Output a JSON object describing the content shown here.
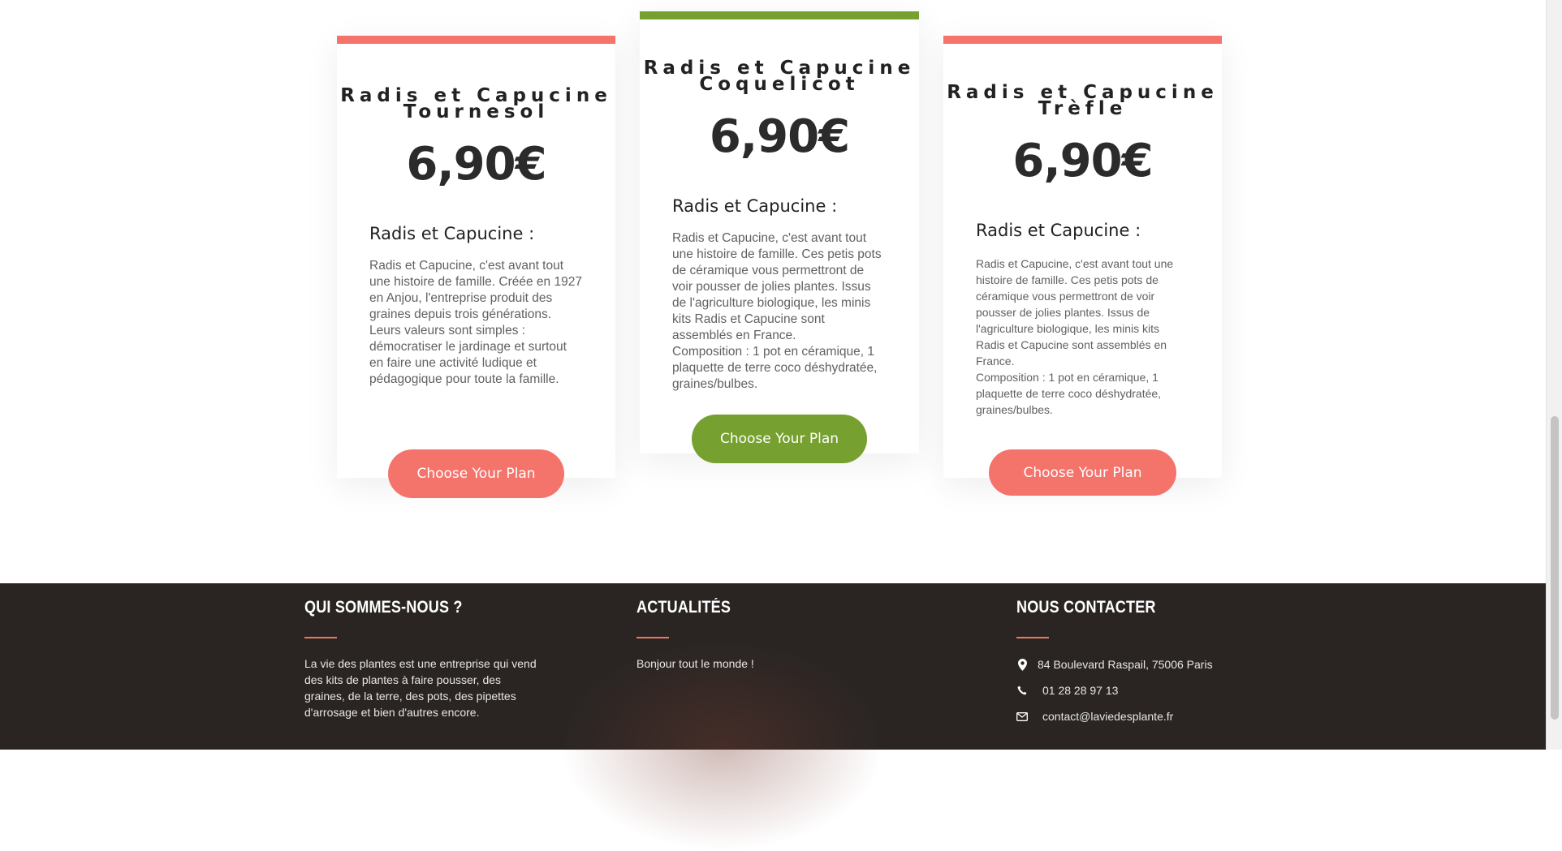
{
  "pricing": {
    "cards": [
      {
        "title_line1": "Radis et Capucine",
        "title_line2": "Tournesol",
        "price": "6,90€",
        "heading": "Radis et Capucine :",
        "description": "Radis et Capucine, c'est avant tout\nune histoire de famille. Créée en 1927\nen Anjou, l'entreprise produit des\ngraines depuis trois générations.\nLeurs valeurs sont simples :\ndémocratiser le jardinage et surtout\nen faire une activité ludique et\npédagogique pour toute la famille.",
        "button_label": "Choose Your Plan",
        "accent_color": "#f4736b"
      },
      {
        "title_line1": "Radis et Capucine",
        "title_line2": "Coquelicot",
        "price": "6,90€",
        "heading": "Radis et Capucine :",
        "description": "Radis et Capucine, c'est avant tout\nune histoire de famille. Ces petis pots\nde céramique vous permettront de\nvoir pousser de jolies plantes. Issus\nde l'agriculture biologique, les minis\nkits Radis et Capucine sont\nassemblés en France.\nComposition : 1 pot en céramique, 1\nplaquette de terre coco déshydratée,\ngraines/bulbes.",
        "button_label": "Choose Your Plan",
        "accent_color": "#76a02f"
      },
      {
        "title_line1": "Radis et Capucine",
        "title_line2": "Trèfle",
        "price": "6,90€",
        "heading": "Radis et Capucine :",
        "description": "Radis et Capucine, c'est avant tout une\nhistoire de famille. Ces petis pots de\ncéramique vous permettront de voir\npousser de jolies plantes. Issus de\nl'agriculture biologique, les minis kits\nRadis et Capucine sont assemblés en\nFrance.\nComposition : 1 pot en céramique, 1\nplaquette de terre coco déshydratée,\ngraines/bulbes.",
        "button_label": "Choose Your Plan",
        "accent_color": "#f4736b"
      }
    ]
  },
  "footer": {
    "about": {
      "title": "QUI SOMMES-NOUS ?",
      "text_lines": [
        "La vie des plantes est une entreprise qui vend",
        "des kits de plantes à faire pousser, des",
        "graines, de la terre, des pots, des pipettes",
        "d'arrosage et bien d'autres encore."
      ]
    },
    "news": {
      "title": "ACTUALITÉS",
      "item": "Bonjour tout le monde !"
    },
    "contact": {
      "title": "NOUS CONTACTER",
      "address": "84 Boulevard Raspail, 75006 Paris",
      "phone": "01 28 28 97 13",
      "email": "contact@laviedesplante.fr"
    },
    "accent_color": "#f0765e",
    "background_color": "#2a2523"
  },
  "icons": {
    "address": "map-pin-icon",
    "phone": "phone-icon",
    "email": "envelope-icon"
  }
}
